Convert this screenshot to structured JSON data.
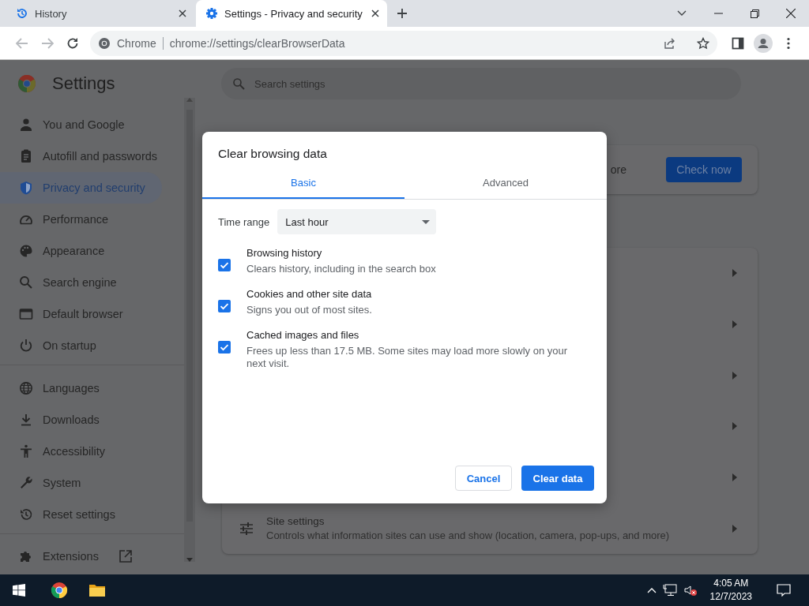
{
  "browser": {
    "tabs": [
      {
        "title": "History",
        "selected": false
      },
      {
        "title": "Settings - Privacy and security",
        "selected": true
      }
    ],
    "omnibox": {
      "site": "Chrome",
      "url": "chrome://settings/clearBrowserData"
    }
  },
  "settings": {
    "title": "Settings",
    "search": {
      "placeholder": "Search settings"
    },
    "sidebar": {
      "groups": [
        {
          "items": [
            {
              "label": "You and Google",
              "selected": false
            },
            {
              "label": "Autofill and passwords",
              "selected": false
            },
            {
              "label": "Privacy and security",
              "selected": true
            },
            {
              "label": "Performance",
              "selected": false
            },
            {
              "label": "Appearance",
              "selected": false
            },
            {
              "label": "Search engine",
              "selected": false
            },
            {
              "label": "Default browser",
              "selected": false
            },
            {
              "label": "On startup",
              "selected": false
            }
          ]
        },
        {
          "items": [
            {
              "label": "Languages",
              "selected": false
            },
            {
              "label": "Downloads",
              "selected": false
            },
            {
              "label": "Accessibility",
              "selected": false
            },
            {
              "label": "System",
              "selected": false
            },
            {
              "label": "Reset settings",
              "selected": false
            }
          ]
        },
        {
          "items": [
            {
              "label": "Extensions",
              "selected": false,
              "kind": "external"
            }
          ]
        }
      ]
    },
    "safety_check": {
      "text": "ore",
      "button": "Check now"
    },
    "site_settings": {
      "title": "Site settings",
      "description": "Controls what information sites can use and show (location, camera, pop-ups, and more)"
    }
  },
  "dialog": {
    "title": "Clear browsing data",
    "tabs": [
      {
        "label": "Basic",
        "selected": true
      },
      {
        "label": "Advanced",
        "selected": false
      }
    ],
    "time_range": {
      "label": "Time range",
      "value": "Last hour"
    },
    "options": [
      {
        "title": "Browsing history",
        "description": "Clears history, including in the search box",
        "checked": true
      },
      {
        "title": "Cookies and other site data",
        "description": "Signs you out of most sites.",
        "checked": true
      },
      {
        "title": "Cached images and files",
        "description": "Frees up less than 17.5 MB. Some sites may load more slowly on your next visit.",
        "checked": true
      }
    ],
    "buttons": [
      {
        "label": "Cancel",
        "kind": "secondary"
      },
      {
        "label": "Clear data",
        "kind": "primary"
      }
    ]
  },
  "taskbar": {
    "time": "4:05 AM",
    "date": "12/7/2023"
  }
}
